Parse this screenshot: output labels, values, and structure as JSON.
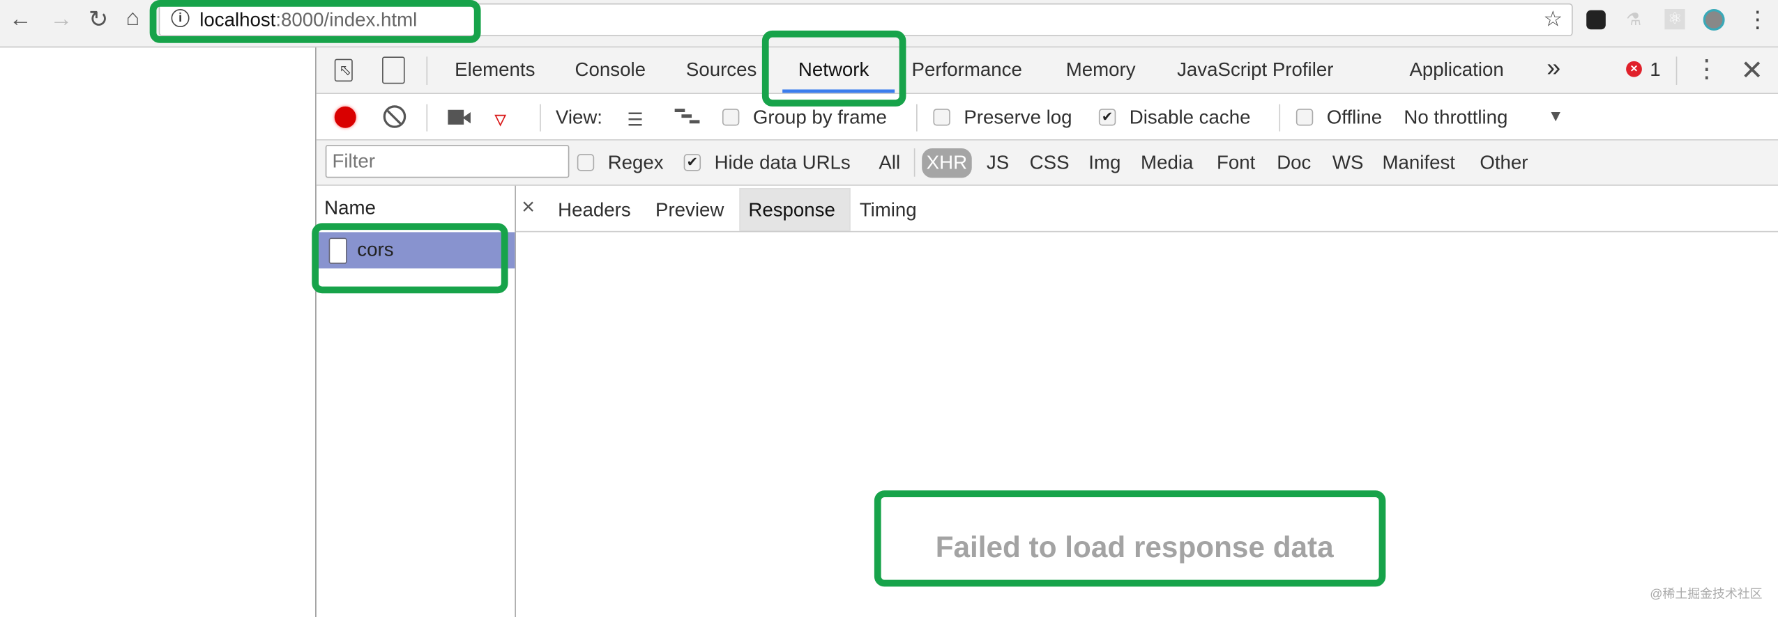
{
  "browser": {
    "url_host": "localhost",
    "url_rest": ":8000/index.html",
    "icons": [
      "back-icon",
      "forward-icon",
      "reload-icon",
      "home-icon",
      "info-icon",
      "star-icon",
      "extension-icons",
      "menu-icon"
    ]
  },
  "devtools": {
    "tabs": [
      "Elements",
      "Console",
      "Sources",
      "Network",
      "Performance",
      "Memory",
      "JavaScript Profiler",
      "Application"
    ],
    "active_tab": "Network",
    "more_tabs": "»",
    "error_count": "1",
    "toolbar": {
      "view_label": "View:",
      "group_by_frame": "Group by frame",
      "preserve_log": "Preserve log",
      "disable_cache": "Disable cache",
      "offline": "Offline",
      "throttling": "No throttling",
      "disable_cache_checked": true
    },
    "filter": {
      "placeholder": "Filter",
      "regex": "Regex",
      "hide_data_urls": "Hide data URLs",
      "hide_data_urls_checked": true,
      "types": [
        "All",
        "XHR",
        "JS",
        "CSS",
        "Img",
        "Media",
        "Font",
        "Doc",
        "WS",
        "Manifest",
        "Other"
      ],
      "active_type": "XHR"
    },
    "requests": {
      "header": "Name",
      "items": [
        "cors"
      ]
    },
    "detail": {
      "close": "×",
      "tabs": [
        "Headers",
        "Preview",
        "Response",
        "Timing"
      ],
      "active_tab": "Response",
      "message": "Failed to load response data"
    }
  },
  "watermark": "@稀土掘金技术社区",
  "colors": {
    "highlight": "#17a34a",
    "selected_row": "#8893cf",
    "active_tab_underline": "#3b7ded",
    "record": "#d90000"
  }
}
